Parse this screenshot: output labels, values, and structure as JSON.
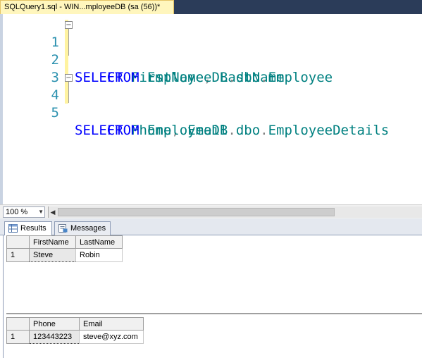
{
  "tab": {
    "title": "SQLQuery1.sql - WIN...mployeeDB (sa (56))*"
  },
  "editor": {
    "lines": [
      {
        "num": "1",
        "parts": [
          {
            "t": "SELECT",
            "c": "kw"
          },
          {
            "t": " ",
            "c": ""
          },
          {
            "t": "FirstName",
            "c": "id"
          },
          {
            "t": ",",
            "c": "pn"
          },
          {
            "t": " ",
            "c": ""
          },
          {
            "t": "LastName",
            "c": "id"
          }
        ]
      },
      {
        "num": "2",
        "parts": [
          {
            "t": "    ",
            "c": ""
          },
          {
            "t": "FROM",
            "c": "kw"
          },
          {
            "t": " ",
            "c": ""
          },
          {
            "t": "EmployeeDB",
            "c": "id"
          },
          {
            "t": ".",
            "c": "pn"
          },
          {
            "t": "dbo",
            "c": "id"
          },
          {
            "t": ".",
            "c": "pn"
          },
          {
            "t": "Employee",
            "c": "id"
          }
        ]
      },
      {
        "num": "3",
        "parts": []
      },
      {
        "num": "4",
        "parts": [
          {
            "t": "SELECT",
            "c": "kw"
          },
          {
            "t": " ",
            "c": ""
          },
          {
            "t": "Phone",
            "c": "id"
          },
          {
            "t": ",",
            "c": "pn"
          },
          {
            "t": " ",
            "c": ""
          },
          {
            "t": "Email",
            "c": "id"
          }
        ]
      },
      {
        "num": "5",
        "parts": [
          {
            "t": "    ",
            "c": ""
          },
          {
            "t": "FROM",
            "c": "kw"
          },
          {
            "t": " ",
            "c": ""
          },
          {
            "t": "EmployeeDB",
            "c": "id"
          },
          {
            "t": ".",
            "c": "pn"
          },
          {
            "t": "dbo",
            "c": "id"
          },
          {
            "t": ".",
            "c": "pn"
          },
          {
            "t": "EmployeeDetails",
            "c": "id"
          }
        ]
      }
    ]
  },
  "zoom": {
    "value": "100 %"
  },
  "result_tabs": {
    "results": "Results",
    "messages": "Messages"
  },
  "grid1": {
    "columns": [
      "FirstName",
      "LastName"
    ],
    "rows": [
      {
        "num": "1",
        "cells": [
          "Steve",
          "Robin"
        ]
      }
    ]
  },
  "grid2": {
    "columns": [
      "Phone",
      "Email"
    ],
    "rows": [
      {
        "num": "1",
        "cells": [
          "123443223",
          "steve@xyz.com"
        ]
      }
    ]
  },
  "colors": {
    "keyword": "#0000ff",
    "identifier": "#008080",
    "line_number": "#2b91af",
    "tab_active": "#fff6bd"
  }
}
